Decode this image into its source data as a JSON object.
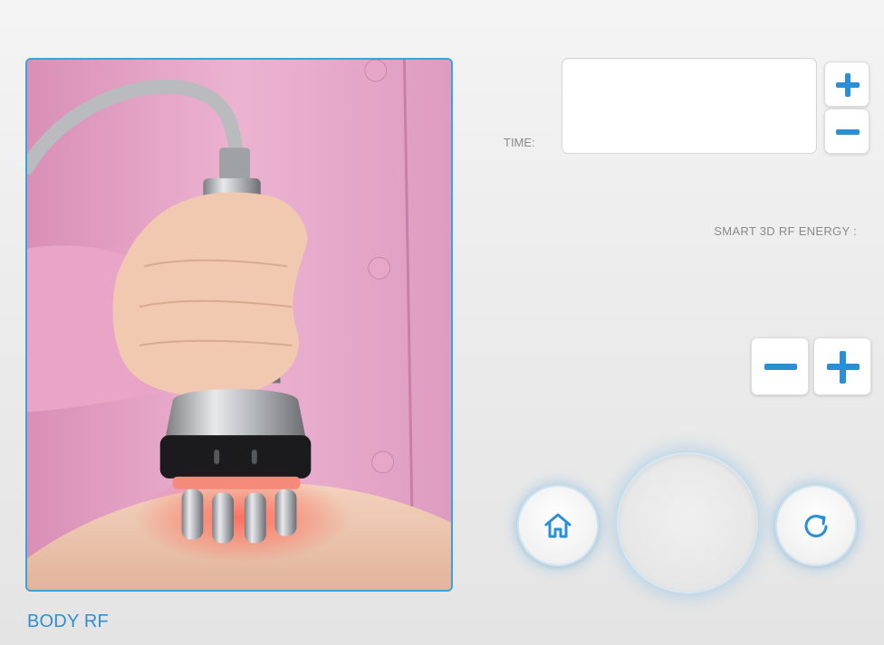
{
  "mode": {
    "caption": "BODY RF"
  },
  "time": {
    "label": "TIME:",
    "value": ""
  },
  "energy": {
    "label": "SMART 3D RF ENERGY :",
    "value": ""
  },
  "controls": {
    "time_increase_icon": "plus-icon",
    "time_decrease_icon": "minus-icon",
    "energy_decrease_icon": "minus-icon",
    "energy_increase_icon": "plus-icon",
    "home_icon": "home-icon",
    "reset_icon": "refresh-icon",
    "start_label": ""
  },
  "colors": {
    "accent": "#2b8fd6",
    "frame_border": "#3aa3d8",
    "caption": "#2f8fd0",
    "label_gray": "#8a8a8a"
  }
}
